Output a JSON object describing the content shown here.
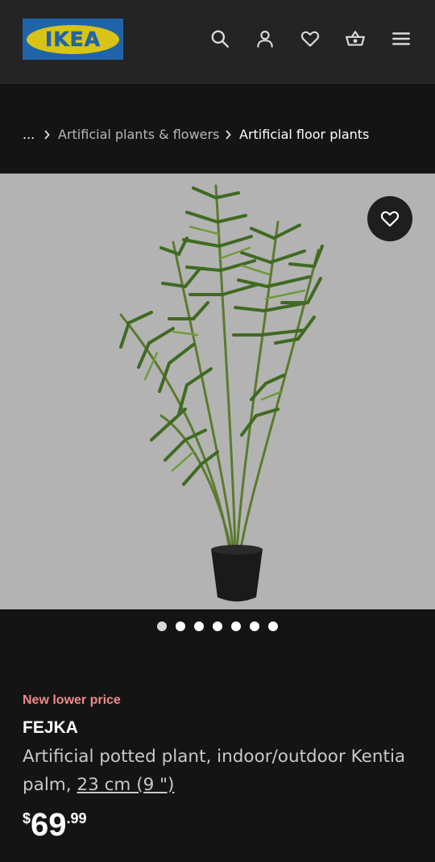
{
  "header": {
    "logo_text": "IKEA",
    "icons": [
      "search-icon",
      "account-icon",
      "heart-icon",
      "basket-icon",
      "menu-icon"
    ]
  },
  "breadcrumb": {
    "ellipsis": "...",
    "items": [
      "Artificial plants & flowers",
      "Artificial floor plants"
    ]
  },
  "gallery": {
    "image_count": 7,
    "active_index": 0
  },
  "product": {
    "badge": "New lower price",
    "name": "FEJKA",
    "description": "Artificial potted plant, indoor/outdoor Kentia palm, ",
    "size": "23 cm (9 \")",
    "price": {
      "currency": "$",
      "integer": "69",
      "decimals": ".99"
    }
  },
  "colors": {
    "background": "#141414",
    "header_bg": "#242424",
    "badge": "#f08a8a",
    "logo_blue": "#1f64a8",
    "logo_yellow": "#d8c316"
  }
}
